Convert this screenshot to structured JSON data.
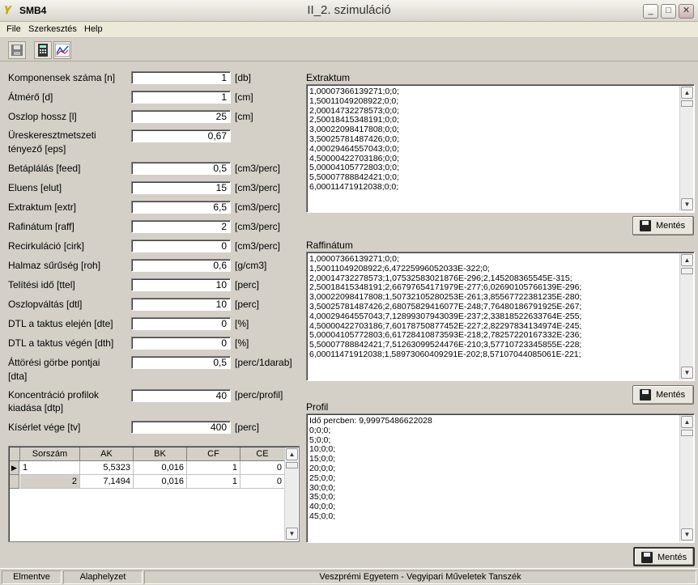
{
  "window": {
    "app_name": "SMB4",
    "title": "II_2. szimuláció",
    "controls": {
      "minimize": "_",
      "maximize": "□",
      "close": "✕"
    }
  },
  "menu": [
    "File",
    "Szerkesztés",
    "Help"
  ],
  "toolbar": {
    "icons": [
      "save-icon",
      "calculator-icon",
      "chart-icon"
    ]
  },
  "form": [
    {
      "label": "Komponensek száma [n]",
      "value": "1",
      "unit": "[db]"
    },
    {
      "label": "Átmérő [d]",
      "value": "1",
      "unit": "[cm]"
    },
    {
      "label": "Oszlop hossz [l]",
      "value": "25",
      "unit": "[cm]"
    },
    {
      "label_lines": [
        "Üreskeresztmetszeti",
        "tényező [eps]"
      ],
      "value": "0,67",
      "unit": ""
    },
    {
      "label": "Betáplálás [feed]",
      "value": "0,5",
      "unit": "[cm3/perc]"
    },
    {
      "label": "Eluens [elut]",
      "value": "15",
      "unit": "[cm3/perc]"
    },
    {
      "label": "Extraktum [extr]",
      "value": "6,5",
      "unit": "[cm3/perc]"
    },
    {
      "label": "Rafinátum [raff]",
      "value": "2",
      "unit": "[cm3/perc]"
    },
    {
      "label": "Recirkuláció [cirk]",
      "value": "0",
      "unit": "[cm3/perc]"
    },
    {
      "label": "Halmaz sűrűség [roh]",
      "value": "0,6",
      "unit": "[g/cm3]"
    },
    {
      "label": "Telítési idő [ttel]",
      "value": "10",
      "unit": "[perc]"
    },
    {
      "label": "Oszlopváltás [dtl]",
      "value": "10",
      "unit": "[perc]"
    },
    {
      "label": "DTL a taktus elején [dte]",
      "value": "0",
      "unit": "[%]"
    },
    {
      "label": "DTL a taktus végén [dth]",
      "value": "0",
      "unit": "[%]"
    },
    {
      "label_lines": [
        "Áttörési görbe pontjai",
        "[dta]"
      ],
      "value": "0,5",
      "unit": "[perc/1darab]"
    },
    {
      "label_lines": [
        "Koncentráció profilok",
        "kiadása [dtp]"
      ],
      "value": "40",
      "unit": "[perc/profil]"
    },
    {
      "label": "Kísérlet vége [tv]",
      "value": "400",
      "unit": "[perc]"
    }
  ],
  "grid": {
    "headers": [
      "Sorszám",
      "AK",
      "BK",
      "CF",
      "CE"
    ],
    "rows": [
      [
        "1",
        "5,5323",
        "0,016",
        "1",
        "0"
      ],
      [
        "2",
        "7,1494",
        "0,016",
        "1",
        "0"
      ]
    ]
  },
  "extraktum": {
    "title": "Extraktum",
    "lines": [
      "1,00007366139271;0;0;",
      "1,50011049208922;0;0;",
      "2,00014732278573;0;0;",
      "2,50018415348191;0;0;",
      "3,00022098417808;0;0;",
      "3,50025781487426;0;0;",
      "4,00029464557043;0;0;",
      "4,50000422703186;0;0;",
      "5,00004105772803;0;0;",
      "5,50007788842421;0;0;",
      "6,00011471912038;0;0;"
    ],
    "save_label": "Mentés"
  },
  "raffinatum": {
    "title": "Raffinátum",
    "lines": [
      "1,00007366139271;0;0;",
      "1,50011049208922;6,47225996052033E-322;0;",
      "2,00014732278573;1,07532583021876E-296;2,145208365545E-315;",
      "2,50018415348191;2,66797654171979E-277;6,02690105766139E-296;",
      "3,00022098417808;1,50732105280253E-261;3,85567722381235E-280;",
      "3,50025781487426;2,68075829416077E-248;7,76480186791925E-267;",
      "4,00029464557043;7,12899307943039E-237;2,33818522633764E-255;",
      "4,50000422703186;7,60178750877452E-227;2,82297834134974E-245;",
      "5,00004105772803;6,61728410873593E-218;2,78257220167332E-236;",
      "5,50007788842421;7,51263099524476E-210;3,57710723345855E-228;",
      "6,00011471912038;1,58973060409291E-202;8,57107044085061E-221;"
    ],
    "save_label": "Mentés"
  },
  "profil": {
    "title": "Profil",
    "lines": [
      "Idő percben: 9,99975486622028",
      "0;0;0;",
      "5;0;0;",
      "10;0;0;",
      "15;0;0;",
      "20;0;0;",
      "25;0;0;",
      "30;0;0;",
      "35;0;0;",
      "40;0;0;",
      "45;0;0;"
    ],
    "save_label": "Mentés"
  },
  "status": {
    "panels": [
      "Elmentve",
      "Alaphelyzet",
      "Veszprémi Egyetem - Vegyipari Műveletek Tanszék"
    ]
  }
}
